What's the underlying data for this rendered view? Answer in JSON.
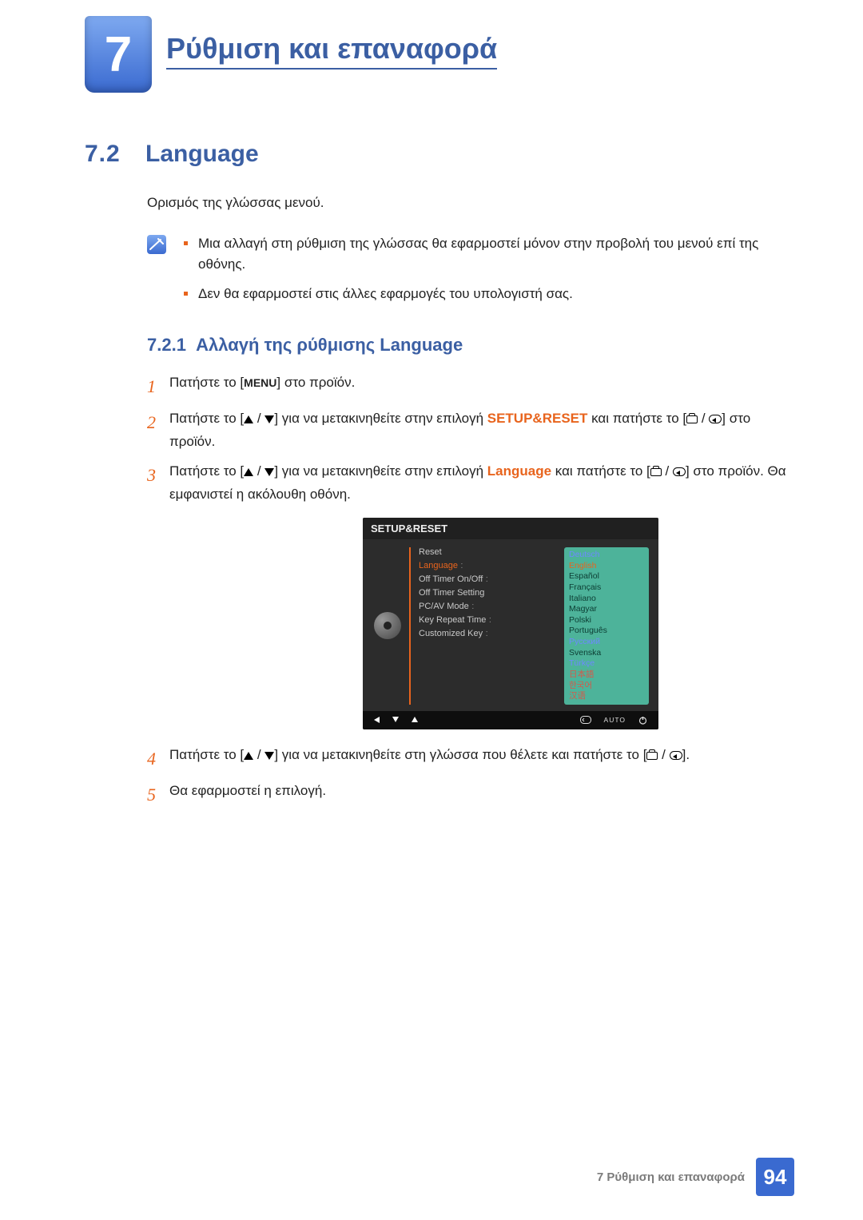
{
  "chapter": {
    "number": "7",
    "title": "Ρύθμιση και επαναφορά"
  },
  "section": {
    "number": "7.2",
    "title": "Language"
  },
  "intro": "Ορισμός της γλώσσας μενού.",
  "notes": [
    "Μια αλλαγή στη ρύθμιση της γλώσσας θα εφαρμοστεί μόνον στην προβολή του μενού επί της οθόνης.",
    "Δεν θα εφαρμοστεί στις άλλες εφαρμογές του υπολογιστή σας."
  ],
  "subsection": {
    "number": "7.2.1",
    "title": "Αλλαγή της ρύθμισης Language"
  },
  "steps": {
    "s1": {
      "a": "Πατήστε το [",
      "menu": "MENU",
      "b": "] στο προϊόν."
    },
    "s2": {
      "a": "Πατήστε το [",
      "mid": "] για να μετακινηθείτε στην επιλογή ",
      "hl": "SETUP&RESET",
      "c": " και πατήστε το [",
      "d": "] στο προϊόν."
    },
    "s3": {
      "a": "Πατήστε το [",
      "mid": "] για να μετακινηθείτε στην επιλογή ",
      "hl": "Language",
      "c": " και πατήστε το [",
      "d": "] στο προϊόν. Θα εμφανιστεί η ακόλουθη οθόνη."
    },
    "s4": {
      "a": "Πατήστε το [",
      "mid": "] για να μετακινηθείτε στη γλώσσα που θέλετε και πατήστε το [",
      "d": "]."
    },
    "s5": {
      "a": "Θα εφαρμοστεί η επιλογή."
    }
  },
  "osd": {
    "title": "SETUP&RESET",
    "menu": [
      "Reset",
      "Language",
      "Off Timer On/Off",
      "Off Timer Setting",
      "PC/AV Mode",
      "Key Repeat Time",
      "Customized Key"
    ],
    "languages": [
      "Deutsch",
      "English",
      "Español",
      "Français",
      "Italiano",
      "Magyar",
      "Polski",
      "Português",
      "Русский",
      "Svenska",
      "Türkçe",
      "日本語",
      "한국어",
      "汉语"
    ],
    "auto": "AUTO"
  },
  "footer": {
    "label": "7 Ρύθμιση και επαναφορά",
    "page": "94"
  }
}
